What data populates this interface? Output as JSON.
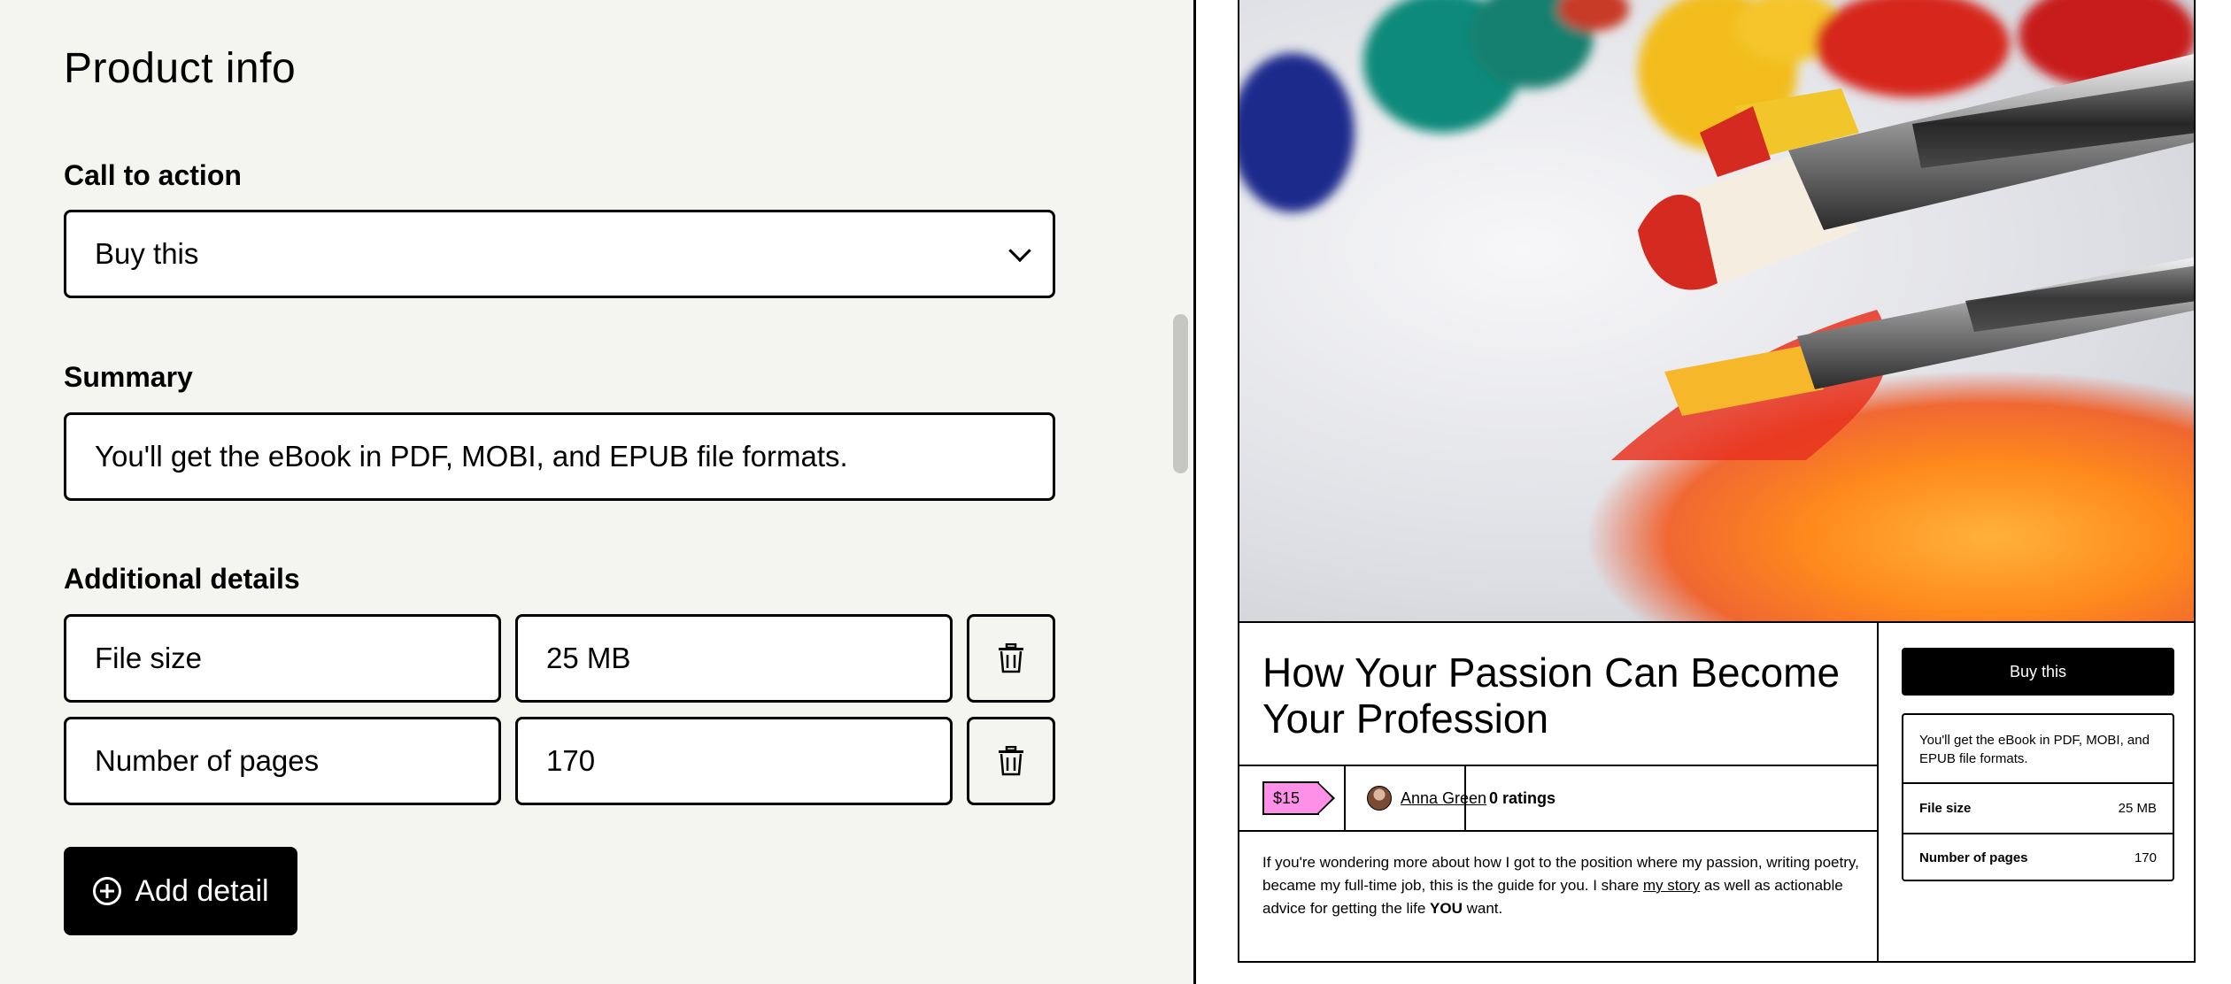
{
  "editor": {
    "section_title": "Product info",
    "call_to_action": {
      "label": "Call to action",
      "value": "Buy this"
    },
    "summary": {
      "label": "Summary",
      "value": "You'll get the eBook in PDF, MOBI, and EPUB file formats."
    },
    "additional_details": {
      "label": "Additional details",
      "rows": [
        {
          "name": "File size",
          "value": "25 MB"
        },
        {
          "name": "Number of pages",
          "value": "170"
        }
      ]
    },
    "add_detail_label": "Add detail"
  },
  "preview": {
    "title": "How Your Passion Can Become Your Profession",
    "price": "$15",
    "creator": "Anna Green",
    "ratings": "0 ratings",
    "description": {
      "part1": "If you're wondering more about how I got to the position where my passion, writing poetry, became my full-time job, this is the guide for you. I share ",
      "link": "my story",
      "part2": " as well as actionable advice for getting the life ",
      "bold": "YOU",
      "part3": " want."
    },
    "buy_button": "Buy this",
    "summary": "You'll get the eBook in PDF, MOBI, and EPUB file formats.",
    "details": [
      {
        "name": "File size",
        "value": "25 MB"
      },
      {
        "name": "Number of pages",
        "value": "170"
      }
    ]
  },
  "colors": {
    "accent_pink": "#ff90e8",
    "background": "#f4f4f0"
  },
  "icons": [
    "chevron-down-icon",
    "trash-icon",
    "plus-circle-icon",
    "avatar"
  ]
}
